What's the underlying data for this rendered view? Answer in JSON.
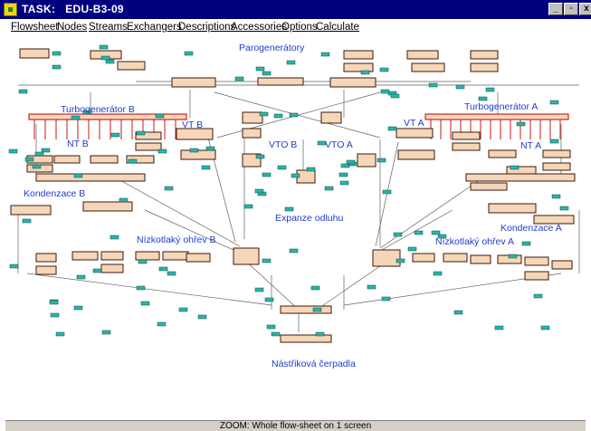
{
  "window": {
    "title": "TASK:   EDU-B3-09"
  },
  "window_controls": {
    "minimize": "_",
    "maximize": "▫",
    "close": "x"
  },
  "menu": {
    "items": [
      "Flowsheet",
      "Nodes",
      "Streams",
      "Exchangers",
      "Descriptions",
      "Accessories",
      "Options",
      "Calculate"
    ]
  },
  "flowsheet": {
    "labels": {
      "paro": "Parogenerátory",
      "tg_b": "Turbogenerátor B",
      "tg_a": "Turbogenerátor A",
      "vt_b": "VT B",
      "vt_a": "VT A",
      "nt_b": "NT B",
      "nt_a": "NT A",
      "vto_b": "VTO B",
      "vto_a": "VTO A",
      "kond_b": "Kondenzace B",
      "kond_a": "Kondenzace A",
      "expanze": "Expanze odluhu",
      "nizko_b": "Nízkotlaký ohřev B",
      "nizko_a": "Nízkotlaký ohřev A",
      "nastrik": "Nástřiková čerpadla"
    },
    "colors": {
      "node_fill": "#f6d6b8",
      "node_border": "#3a1a0a",
      "stream_tag": "#2bb5a8",
      "line": "#606060",
      "accent": "#c00000"
    }
  },
  "status": {
    "zoom_text": "ZOOM: Whole flow-sheet on 1 screen"
  }
}
